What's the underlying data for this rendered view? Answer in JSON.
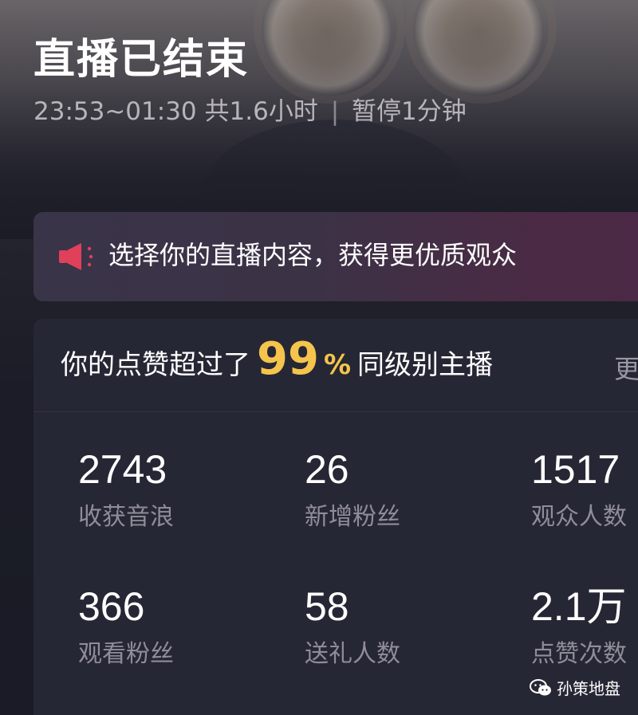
{
  "header": {
    "title": "直播已结束",
    "time_range": "23:53~01:30",
    "duration": "共1.6小时",
    "separator": "|",
    "paused": "暂停1分钟"
  },
  "banner": {
    "icon": "megaphone-icon",
    "text": "选择你的直播内容，获得更优质观众"
  },
  "likes_summary": {
    "prefix": "你的点赞超过了",
    "percent": "99",
    "percent_sign": "%",
    "suffix": "同级别主播",
    "more": "更"
  },
  "stats": [
    {
      "value": "2743",
      "label": "收获音浪"
    },
    {
      "value": "26",
      "label": "新增粉丝"
    },
    {
      "value": "1517",
      "label": "观众人数"
    },
    {
      "value": "366",
      "label": "观看粉丝"
    },
    {
      "value": "58",
      "label": "送礼人数"
    },
    {
      "value": "2.1万",
      "label": "点赞次数"
    }
  ],
  "watermark": {
    "icon": "wechat-icon",
    "text": "孙策地盘"
  },
  "colors": {
    "accent_yellow": "#f5c44c",
    "megaphone_red": "#e0405a",
    "card_bg": "#262734",
    "label_gray": "#8f8d99"
  }
}
